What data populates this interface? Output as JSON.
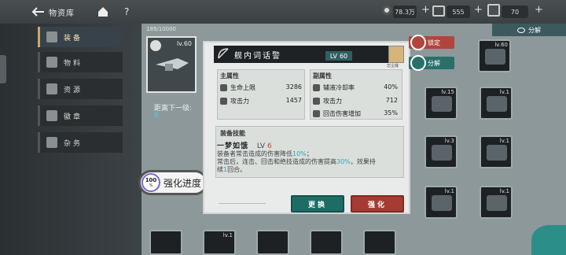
{
  "header": {
    "title": "物资库",
    "help": "?",
    "resource1_value": "78.3万",
    "resource2_value": "555",
    "resource3_value": "70"
  },
  "tabs": [
    {
      "label": "装备",
      "active": true
    },
    {
      "label": "物料",
      "active": false
    },
    {
      "label": "资源",
      "active": false
    },
    {
      "label": "徽章",
      "active": false
    },
    {
      "label": "杂务",
      "active": false
    }
  ],
  "inventory": {
    "count": "189/10000",
    "decompose_label": "分解",
    "slots": [
      {
        "level": "lv.60"
      },
      {
        "level": "lv.15"
      },
      {
        "level": "lv.1"
      },
      {
        "level": "lv.3"
      },
      {
        "level": "lv.1"
      },
      {
        "level": "lv.1"
      },
      {
        "level": "lv.1"
      },
      {
        "level": "lv.1"
      }
    ]
  },
  "selected": {
    "level": "lv.60",
    "next_level_label": "距离下一级:",
    "next_level_value": "0",
    "progress_percent_label": "100",
    "progress_percent_sign": "%",
    "progress_label": "强化进度"
  },
  "detail": {
    "name": "舰内词话警",
    "level_label": "LV",
    "level": "60",
    "owner": "忘尘哉",
    "main_stats_title": "主属性",
    "main_stats": [
      {
        "name": "生命上限",
        "value": "3286"
      },
      {
        "name": "攻击力",
        "value": "1457"
      }
    ],
    "sub_stats_title": "副属性",
    "sub_stats": [
      {
        "name": "辅液冷却率",
        "value": "40%"
      },
      {
        "name": "攻击力",
        "value": "712"
      },
      {
        "name": "回击伤害增加",
        "value": "35%"
      }
    ],
    "skill_title": "装备技能",
    "skill_name": "一梦如饿",
    "skill_level_label": "LV",
    "skill_level": "6",
    "skill_line1_a": "装备者常击造成的伤害降低",
    "skill_line1_b": "10%",
    "skill_line1_c": "；",
    "skill_line2_a": "常击后，连击、回击和绝技造成的伤害提高",
    "skill_line2_b": "30%",
    "skill_line2_c": "，效果持",
    "skill_line3_a": "续",
    "skill_line3_b": "1",
    "skill_line3_c": "回合。",
    "replace_button": "更换",
    "upgrade_button": "强化",
    "lock_button": "锁定",
    "decompose_button": "分解"
  },
  "colors": {
    "accent_cyan": "#29a9b6",
    "replace_green": "#1d6d66",
    "upgrade_red": "#a53b32",
    "lock_red": "#b1443c",
    "level_tag": "#2f5f63"
  }
}
